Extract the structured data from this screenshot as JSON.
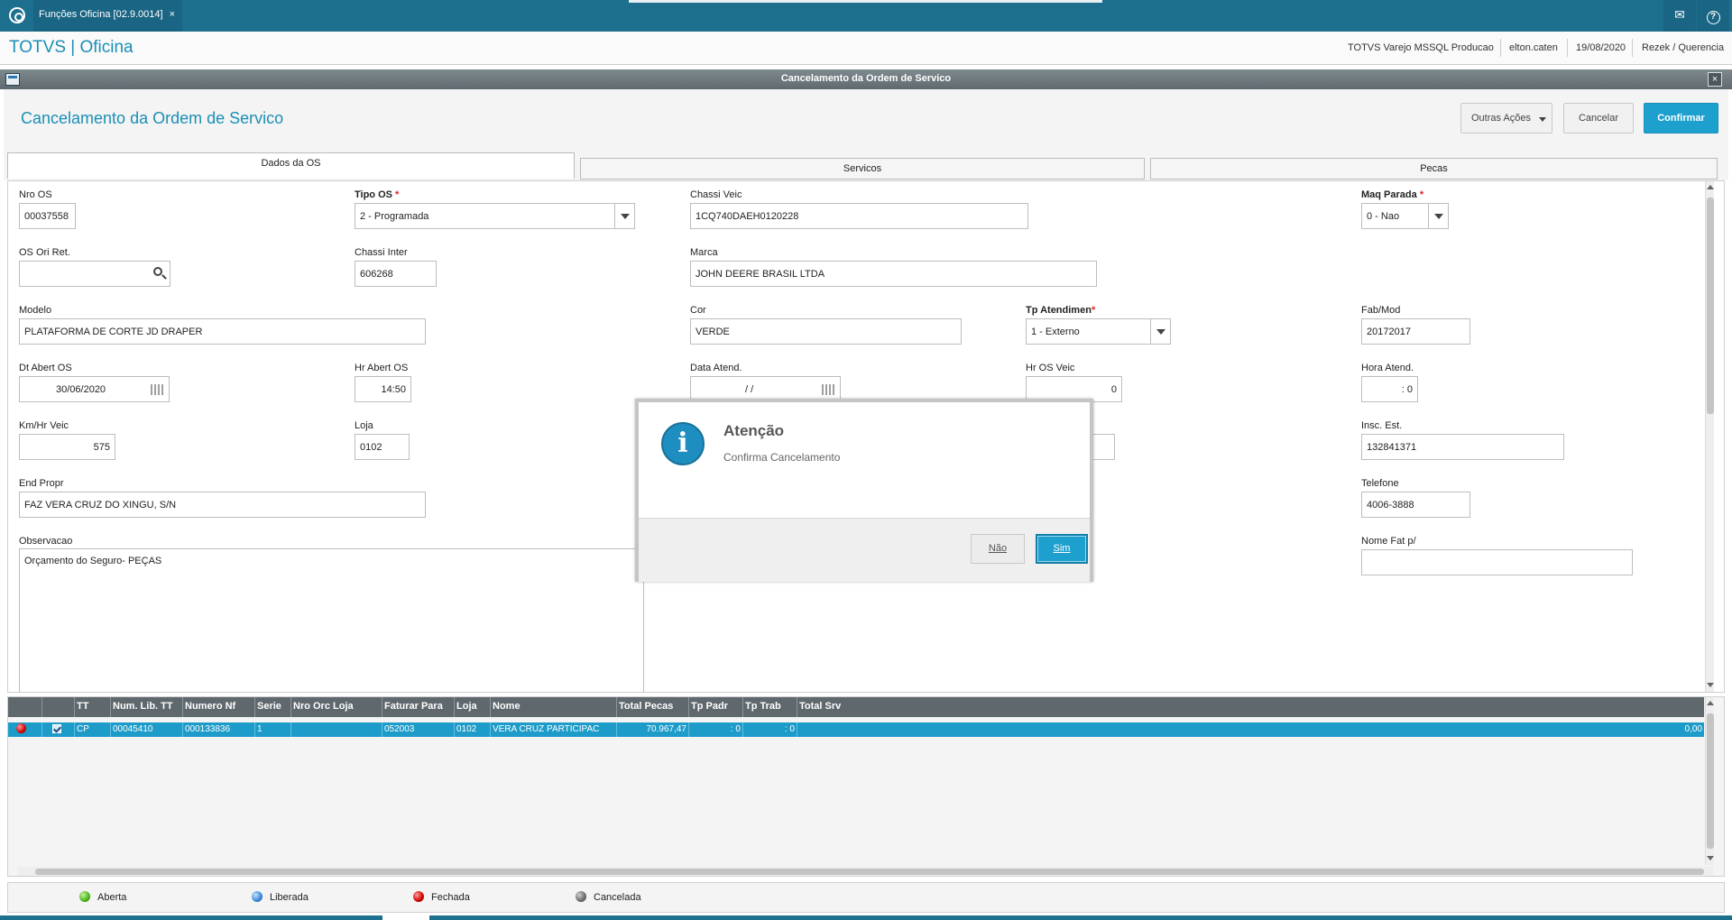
{
  "topbar": {
    "tab_label": "Funções Oficina [02.9.0014]",
    "tab_close": "×",
    "mail_icon": "mail-icon",
    "help_icon": "?"
  },
  "header": {
    "brand": "TOTVS | Oficina",
    "environment": "TOTVS Varejo MSSQL Producao",
    "user": "elton.caten",
    "date": "19/08/2020",
    "company": "Rezek / Querencia"
  },
  "window": {
    "title": "Cancelamento da Ordem de Servico",
    "close": "×"
  },
  "page": {
    "title": "Cancelamento da Ordem de Servico",
    "buttons": {
      "other_actions": "Outras Ações",
      "cancel": "Cancelar",
      "confirm": "Confirmar"
    }
  },
  "tabs": [
    "Dados da OS",
    "Servicos",
    "Pecas"
  ],
  "form": {
    "nro_os": {
      "label": "Nro OS",
      "value": "00037558"
    },
    "tipo_os": {
      "label": "Tipo OS",
      "required": "*",
      "value": "2 - Programada"
    },
    "chassi_veic": {
      "label": "Chassi Veic",
      "value": "1CQ740DAEH0120228"
    },
    "maq_parada": {
      "label": "Maq Parada",
      "required": "*",
      "value": "0 - Nao"
    },
    "os_ori_ret": {
      "label": "OS Ori Ret.",
      "value": ""
    },
    "chassi_inter": {
      "label": "Chassi Inter",
      "value": "606268"
    },
    "marca": {
      "label": "Marca",
      "value": "JOHN DEERE BRASIL LTDA"
    },
    "modelo": {
      "label": "Modelo",
      "value": "PLATAFORMA DE CORTE JD DRAPER"
    },
    "cor": {
      "label": "Cor",
      "value": "VERDE"
    },
    "tp_atendimen": {
      "label": "Tp Atendimen",
      "required": "*",
      "value": "1 - Externo"
    },
    "fab_mod": {
      "label": "Fab/Mod",
      "value": "20172017"
    },
    "dt_abert_os": {
      "label": "Dt Abert OS",
      "value": "30/06/2020"
    },
    "hr_abert_os": {
      "label": "Hr Abert OS",
      "value": "14:50"
    },
    "data_atend": {
      "label": "Data Atend.",
      "value": "/  /"
    },
    "hr_os_veic": {
      "label": "Hr OS Veic",
      "value": "0"
    },
    "hora_atend": {
      "label": "Hora Atend.",
      "value": ": 0"
    },
    "km_hr_veic": {
      "label": "Km/Hr Veic",
      "value": "575"
    },
    "loja": {
      "label": "Loja",
      "value": "0102"
    },
    "insc_est": {
      "label": "Insc. Est.",
      "value": "132841371"
    },
    "end_propr": {
      "label": "End Propr",
      "value": "FAZ VERA CRUZ DO XINGU, S/N"
    },
    "telefone": {
      "label": "Telefone",
      "value": "4006-3888"
    },
    "observacao": {
      "label": "Observacao",
      "value": "Orçamento do Seguro- PEÇAS"
    },
    "nome_fat": {
      "label": "Nome Fat p/",
      "value": ""
    }
  },
  "grid": {
    "columns": [
      "",
      "",
      "TT",
      "Num. Lib. TT",
      "Numero Nf",
      "Serie",
      "Nro Orc Loja",
      "Faturar Para",
      "Loja",
      "Nome",
      "Total Pecas",
      "Tp Padr",
      "Tp Trab",
      "Total Srv"
    ],
    "row": {
      "tt": "CP",
      "num_lib_tt": "00045410",
      "numero_nf": "000133836",
      "serie": "1",
      "nro_orc_loja": "",
      "faturar_para": "052003",
      "loja": "0102",
      "nome": "VERA CRUZ PARTICIPAC",
      "total_pecas": "70.967,47",
      "tp_padr": ": 0",
      "tp_trab": ": 0",
      "total_srv": "0,00"
    }
  },
  "legend": {
    "aberta": "Aberta",
    "liberada": "Liberada",
    "fechada": "Fechada",
    "cancelada": "Cancelada"
  },
  "dialog": {
    "icon": "i",
    "title": "Atenção",
    "message": "Confirma Cancelamento",
    "no": "Não",
    "yes": "Sim"
  },
  "colors": {
    "topbar": "#1d6f8e",
    "accent": "#1ea0cf",
    "brand": "#1b8fb5"
  }
}
